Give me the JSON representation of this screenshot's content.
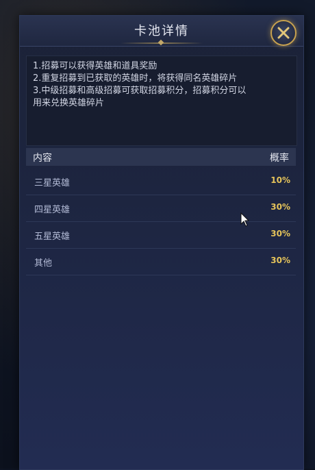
{
  "dialog": {
    "title": "卡池详情"
  },
  "description": {
    "lines": [
      "1.招募可以获得英雄和道具奖励",
      "2.重复招募到已获取的英雄时，将获得同名英雄碎片",
      "3.中级招募和高级招募可获取招募积分，招募积分可以",
      "用来兑换英雄碎片"
    ]
  },
  "table": {
    "headers": {
      "content": "内容",
      "probability": "概率"
    },
    "rows": [
      {
        "name": "三星英雄",
        "probability": "10%"
      },
      {
        "name": "四星英雄",
        "probability": "30%"
      },
      {
        "name": "五星英雄",
        "probability": "30%"
      },
      {
        "name": "其他",
        "probability": "30%"
      }
    ]
  },
  "colors": {
    "accent_gold": "#c8a24f",
    "probability_text": "#e6c45a",
    "panel_bg": "#1d2540"
  },
  "icons": {
    "close": "close-x-icon",
    "cursor": "mouse-pointer-icon"
  }
}
